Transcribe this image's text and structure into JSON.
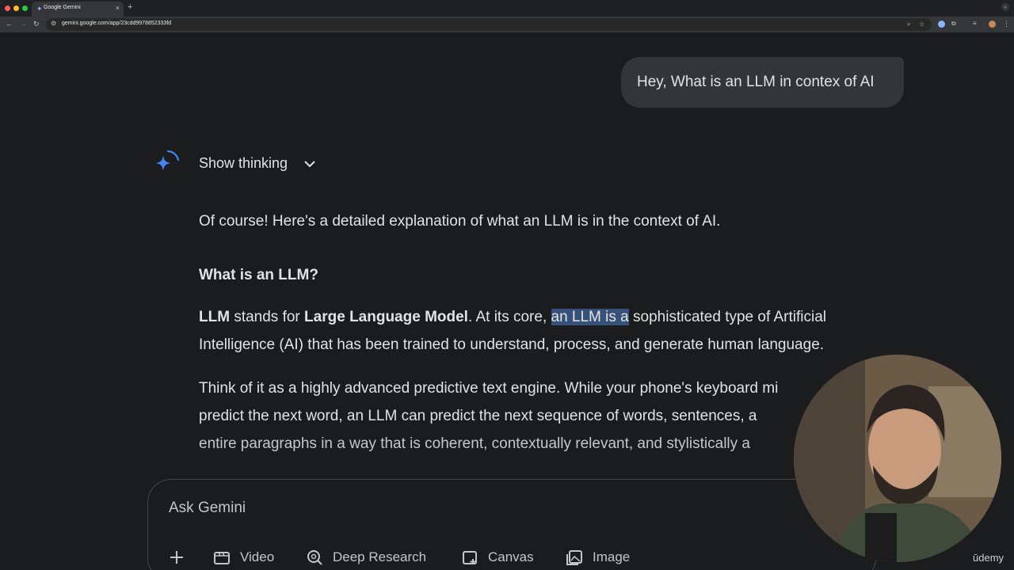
{
  "browser": {
    "tab_title": "Google Gemini",
    "url": "gemini.google.com/app/23cdd9978852333fd"
  },
  "chat": {
    "user_message": "Hey, What is an LLM in contex of AI",
    "show_thinking": "Show thinking",
    "intro": "Of course! Here's a detailed explanation of what an LLM is in the context of AI.",
    "heading": "What is an LLM?",
    "para1": {
      "llm": "LLM",
      "stands_for": " stands for ",
      "full_name": "Large Language Model",
      "core_before": ". At its core, ",
      "highlight": "an LLM is a",
      "core_after": " sophisticated type of Artificial",
      "line2": "Intelligence (AI) that has been trained to understand, process, and generate human language."
    },
    "para2": {
      "line1": "Think of it as a highly advanced predictive text engine. While your phone's keyboard mi",
      "line2": "predict the next word, an LLM can predict the next sequence of words, sentences, a",
      "line3": "entire paragraphs in a way that is coherent, contextually relevant, and stylistically a"
    }
  },
  "composer": {
    "placeholder": "Ask Gemini",
    "tools": {
      "video": "Video",
      "deep_research": "Deep Research",
      "canvas": "Canvas",
      "image": "Image"
    }
  },
  "overlay": {
    "watermark": "ūdemy"
  },
  "colors": {
    "background": "#1b1c1d",
    "bubble": "#333537",
    "highlight": "#37527a",
    "gemini_blue": "#4285f4"
  }
}
